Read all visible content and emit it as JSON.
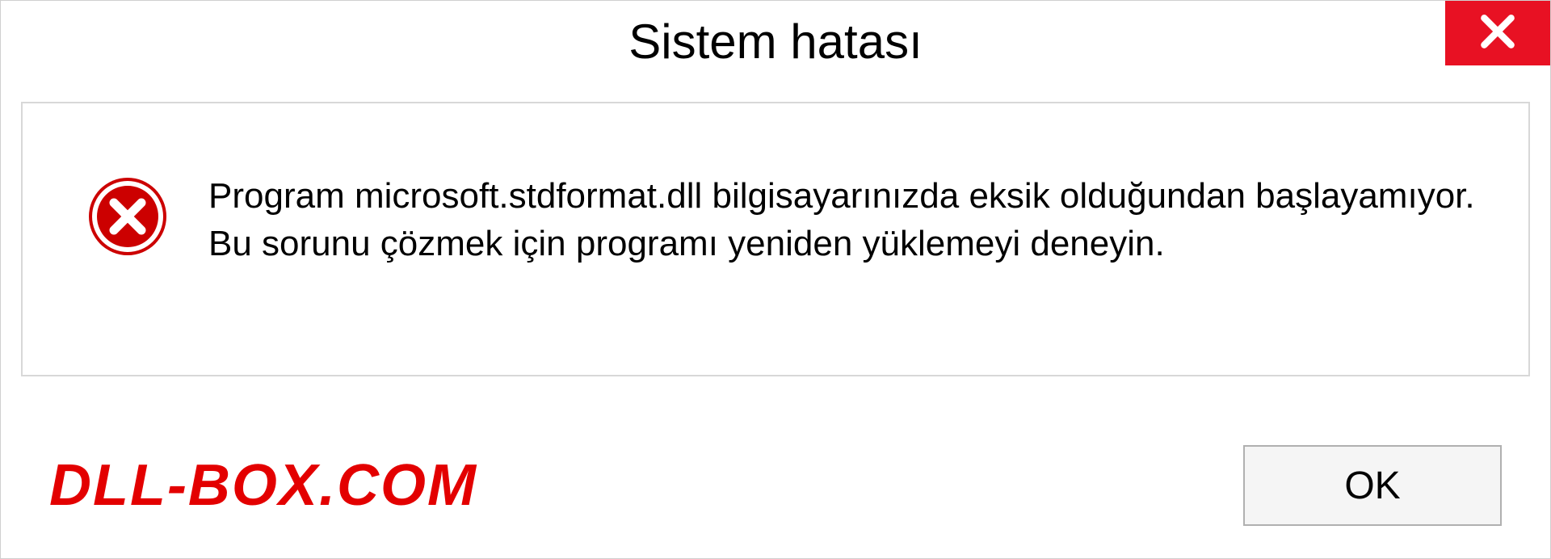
{
  "dialog": {
    "title": "Sistem hatası",
    "message": "Program microsoft.stdformat.dll bilgisayarınızda eksik olduğundan başlayamıyor. Bu sorunu çözmek için programı yeniden yüklemeyi deneyin.",
    "ok_label": "OK"
  },
  "watermark": "DLL-BOX.COM",
  "colors": {
    "close_red": "#e81123",
    "error_red": "#cc0000",
    "watermark_red": "#e30000"
  }
}
